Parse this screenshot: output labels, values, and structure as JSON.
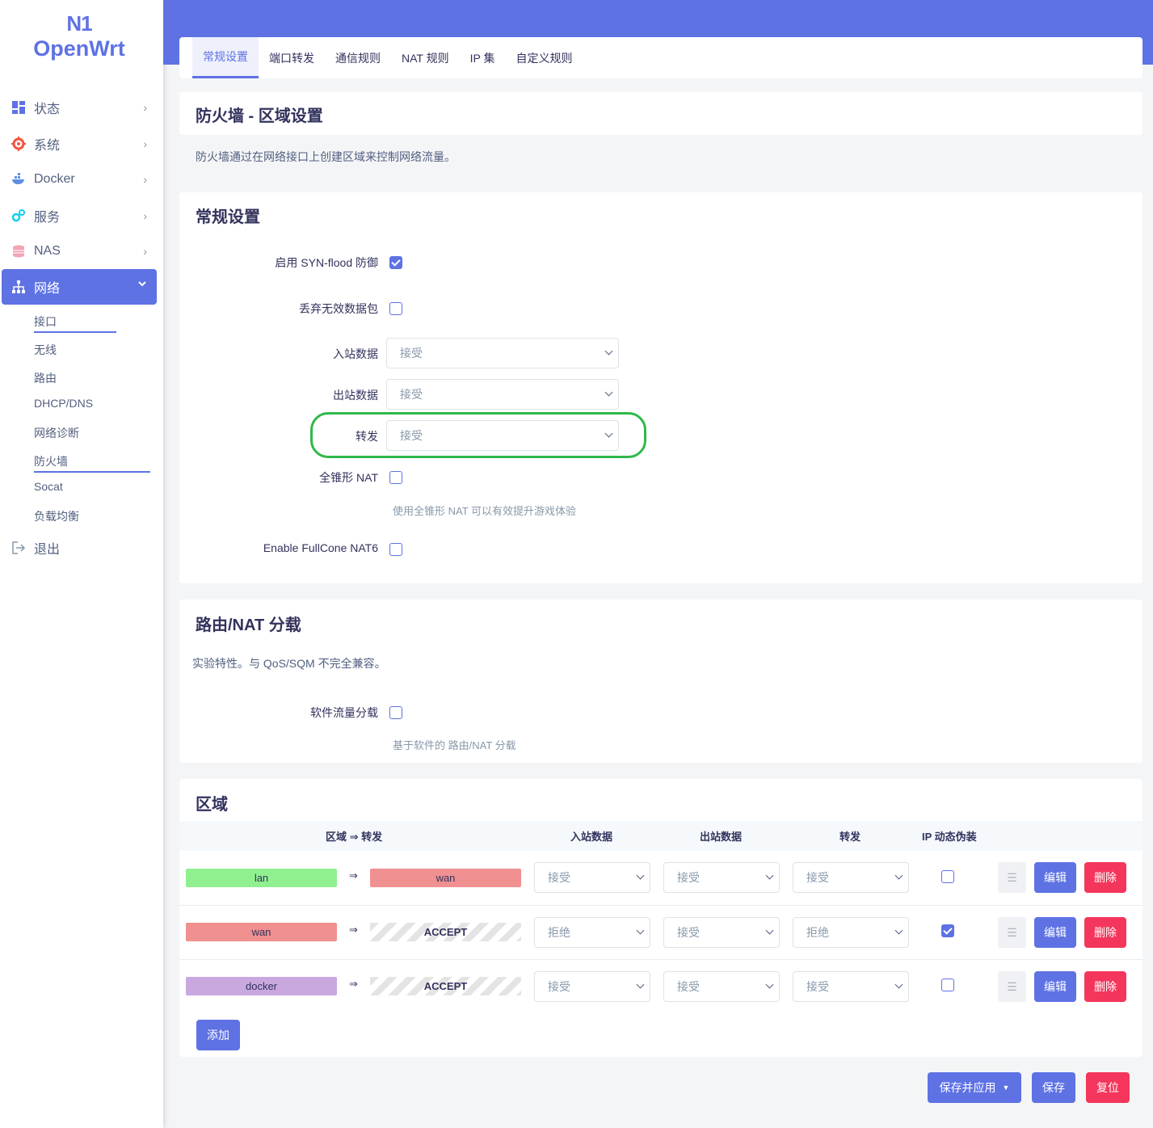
{
  "logo": {
    "line1": "N1",
    "line2": "OpenWrt"
  },
  "sidebar": {
    "items": [
      {
        "label": "状态",
        "icon": "dashboard-icon"
      },
      {
        "label": "系统",
        "icon": "gear-icon"
      },
      {
        "label": "Docker",
        "icon": "docker-icon"
      },
      {
        "label": "服务",
        "icon": "services-icon"
      },
      {
        "label": "NAS",
        "icon": "database-icon"
      },
      {
        "label": "网络",
        "icon": "network-icon"
      },
      {
        "label": "退出",
        "icon": "logout-icon"
      }
    ],
    "network_sub": [
      "接口",
      "无线",
      "路由",
      "DHCP/DNS",
      "网络诊断",
      "防火墙",
      "Socat",
      "负载均衡"
    ]
  },
  "tabs": [
    "常规设置",
    "端口转发",
    "通信规则",
    "NAT 规则",
    "IP 集",
    "自定义规则"
  ],
  "page": {
    "title": "防火墙 - 区域设置",
    "description": "防火墙通过在网络接口上创建区域来控制网络流量。"
  },
  "general": {
    "title": "常规设置",
    "syn_flood_label": "启用 SYN-flood 防御",
    "syn_flood_checked": true,
    "drop_invalid_label": "丢弃无效数据包",
    "input_label": "入站数据",
    "input_value": "接受",
    "output_label": "出站数据",
    "output_value": "接受",
    "forward_label": "转发",
    "forward_value": "接受",
    "fullcone_label": "全锥形 NAT",
    "fullcone_hint": "使用全锥形 NAT 可以有效提升游戏体验",
    "fullcone6_label": "Enable FullCone NAT6"
  },
  "offload": {
    "title": "路由/NAT 分载",
    "description": "实验特性。与 QoS/SQM 不完全兼容。",
    "sw_label": "软件流量分载",
    "sw_hint": "基于软件的 路由/NAT 分载"
  },
  "zones": {
    "title": "区域",
    "headers": {
      "zone": "区域 ⇒ 转发",
      "input": "入站数据",
      "output": "出站数据",
      "forward": "转发",
      "masq": "IP 动态伪装"
    },
    "arrow": "⇒",
    "rows": [
      {
        "name": "lan",
        "name_color": "#90f090",
        "dest": "wan",
        "dest_color": "#f09090",
        "input": "接受",
        "output": "接受",
        "forward": "接受",
        "masq": false
      },
      {
        "name": "wan",
        "name_color": "#f09090",
        "dest": "ACCEPT",
        "dest_color": "",
        "input": "拒绝",
        "output": "接受",
        "forward": "拒绝",
        "masq": true
      },
      {
        "name": "docker",
        "name_color": "#c9a8e0",
        "dest": "ACCEPT",
        "dest_color": "",
        "input": "接受",
        "output": "接受",
        "forward": "接受",
        "masq": false
      }
    ],
    "sort_glyph": "☰",
    "edit_label": "编辑",
    "delete_label": "删除",
    "add_label": "添加"
  },
  "footer": {
    "save_apply": "保存并应用",
    "save_apply_caret": "▼",
    "save": "保存",
    "reset": "复位"
  },
  "colors": {
    "accent": "#5e72e4",
    "danger": "#f5365c",
    "annotation": "#2fb84a"
  }
}
